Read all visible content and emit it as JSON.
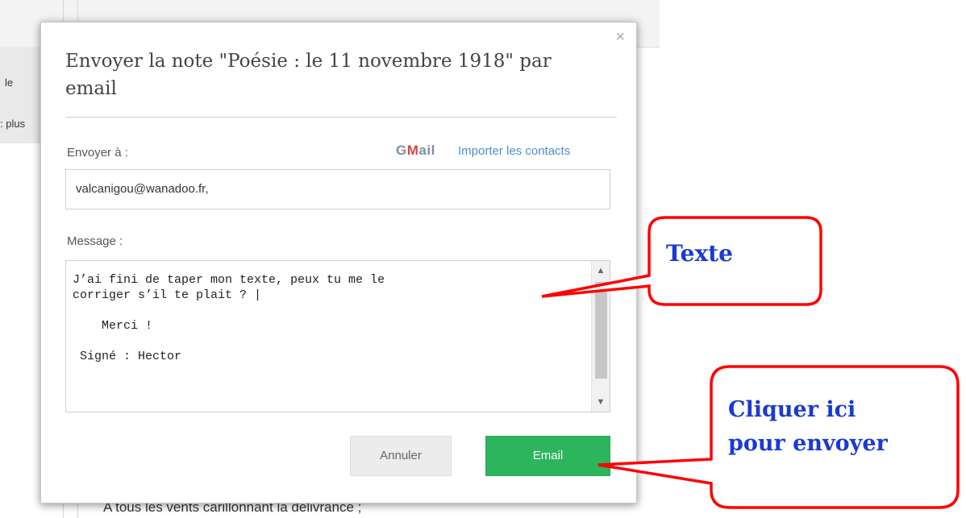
{
  "background": {
    "left_fragment_1": "le",
    "left_fragment_2": ": plus",
    "bottom_line": "A tous les vents carillonnant la délivrance ;"
  },
  "modal": {
    "close_label": "×",
    "title": "Envoyer la note \"Poésie : le 11 novembre 1918\" par email",
    "to_label": "Envoyer à :",
    "gmail_logo": {
      "g": "G",
      "m": "M",
      "ail": "ail"
    },
    "import_contacts_label": "Importer les contacts",
    "to_value": "valcanigou@wanadoo.fr,",
    "message_label": "Message :",
    "message_value": "J’ai fini de taper mon texte, peux tu me le\ncorriger s’il te plait ? |\n\n    Merci !\n\n Signé : Hector",
    "cancel_label": "Annuler",
    "email_label": "Email"
  },
  "callouts": {
    "text_1": "Texte",
    "text_2_line1": "Cliquer ici",
    "text_2_line2": "pour envoyer",
    "border_color": "#ff0000",
    "text_color": "#1a3ad1"
  },
  "colors": {
    "email_button": "#2db55d",
    "link": "#4a8fd1"
  }
}
